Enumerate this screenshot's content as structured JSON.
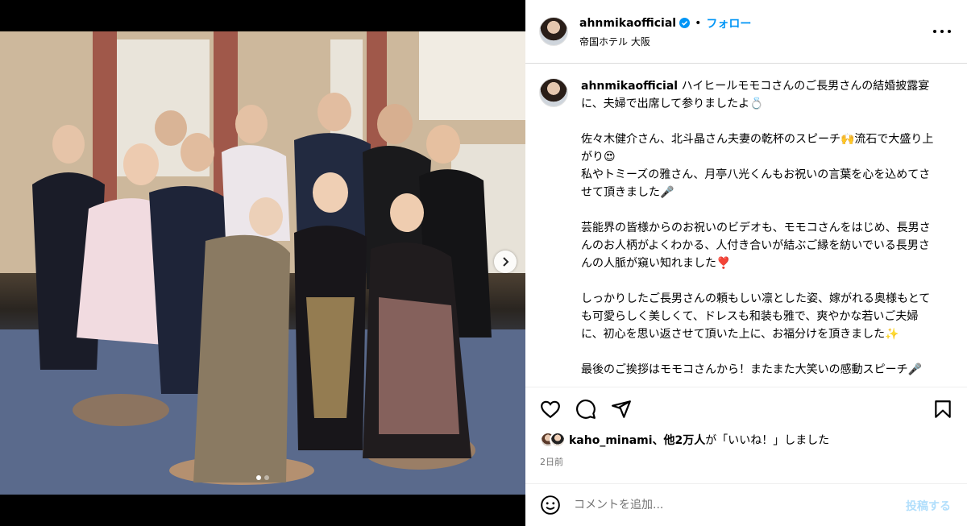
{
  "post": {
    "username": "ahnmikaofficial",
    "separator": "•",
    "follow_label": "フォロー",
    "location": "帝国ホテル 大阪",
    "more_icon": "more-horizontal-icon"
  },
  "caption": {
    "username": "ahnmikaofficial",
    "paragraphs": [
      "ハイヒールモモコさんのご長男さんの結婚披露宴に、夫婦で出席して参りましたよ💍",
      "佐々木健介さん、北斗晶さん夫妻の乾杯のスピーチ🙌流石で大盛り上がり😍\n私やトミーズの雅さん、月亭八光くんもお祝いの言葉を心を込めてさせて頂きました🎤",
      "芸能界の皆様からのお祝いのビデオも、モモコさんをはじめ、長男さんのお人柄がよくわかる、人付き合いが結ぶご縁を紡いでいる長男さんの人脈が窺い知れました❣️",
      "しっかりしたご長男さんの頼もしい凛とした姿、嫁がれる奥様もとても可愛らしく美しくて、ドレスも和装も雅で、爽やかな若いご夫婦に、初心を思い返させて頂いた上に、お福分けを頂きました✨",
      "最後のご挨拶はモモコさんから！またまた大笑いの感動スピーチ🎤"
    ]
  },
  "actions": {
    "icons": [
      "heart-icon",
      "comment-icon",
      "share-icon",
      "bookmark-icon"
    ]
  },
  "likes": {
    "user": "kaho_minami",
    "others": "、他2万人",
    "suffix": "が「いいね！」しました"
  },
  "timestamp": "2日前",
  "comment": {
    "placeholder": "コメントを追加...",
    "post_label": "投稿する"
  },
  "carousel": {
    "slide_count": 2,
    "current_slide": 1
  },
  "colors": {
    "accent": "#0095f6",
    "post_disabled": "#b2dffc",
    "muted": "#737373",
    "border": "#dbdbdb"
  }
}
